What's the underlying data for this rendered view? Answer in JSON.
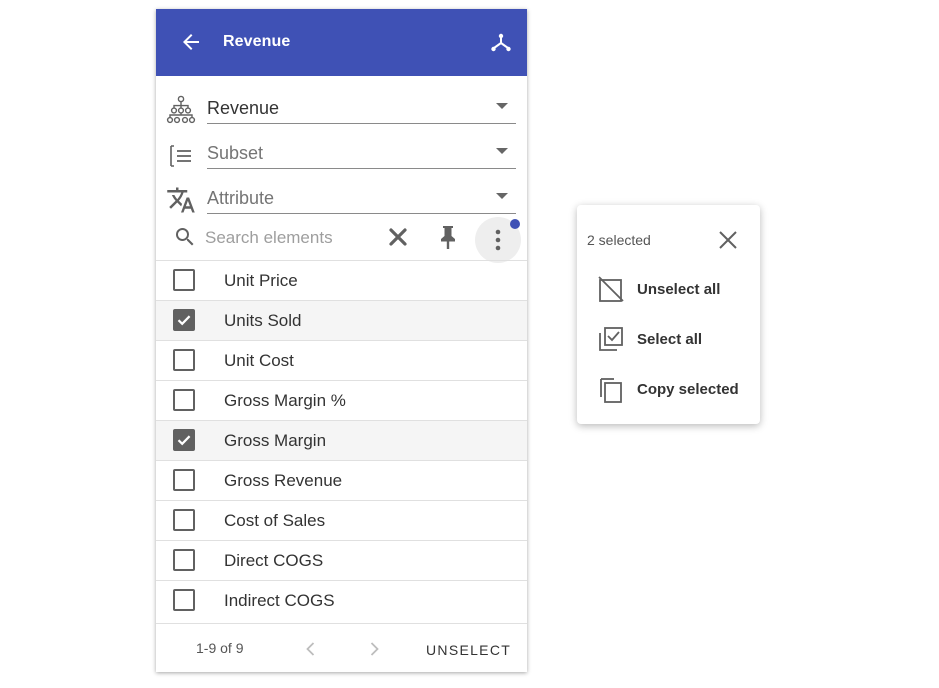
{
  "header": {
    "title": "Revenue",
    "back_icon": "arrow-left-icon",
    "hierarchy_icon": "hierarchy-icon",
    "bg_color": "#3f51b5"
  },
  "selectors": [
    {
      "value": "Revenue",
      "placeholder": "",
      "icon": "hierarchy-tree-icon"
    },
    {
      "value": "",
      "placeholder": "Subset",
      "icon": "subset-list-icon"
    },
    {
      "value": "",
      "placeholder": "Attribute",
      "icon": "translate-icon"
    }
  ],
  "search": {
    "placeholder": "Search elements",
    "value": ""
  },
  "elements": [
    {
      "label": "Unit Price",
      "checked": false
    },
    {
      "label": "Units Sold",
      "checked": true
    },
    {
      "label": "Unit Cost",
      "checked": false
    },
    {
      "label": "Gross Margin %",
      "checked": false
    },
    {
      "label": "Gross Margin",
      "checked": true
    },
    {
      "label": "Gross Revenue",
      "checked": false
    },
    {
      "label": "Cost of Sales",
      "checked": false
    },
    {
      "label": "Direct COGS",
      "checked": false
    },
    {
      "label": "Indirect COGS",
      "checked": false
    }
  ],
  "footer": {
    "range": "1-9 of 9",
    "unselect_label": "UNSELECT"
  },
  "menu": {
    "count_label": "2 selected",
    "items": [
      {
        "label": "Unselect all",
        "icon": "unselect-all-icon"
      },
      {
        "label": "Select all",
        "icon": "select-all-icon"
      },
      {
        "label": "Copy selected",
        "icon": "copy-icon"
      }
    ]
  }
}
